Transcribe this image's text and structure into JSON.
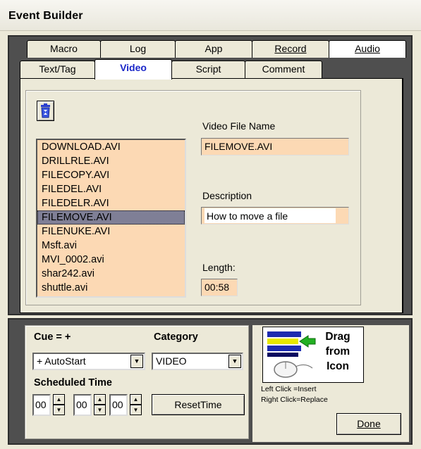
{
  "window": {
    "title": "Event Builder"
  },
  "tabs": {
    "row_back": [
      {
        "label": "Macro"
      },
      {
        "label": "Log"
      },
      {
        "label": "App"
      },
      {
        "label": "Record"
      },
      {
        "label": "Audio"
      }
    ],
    "row_front": [
      {
        "label": "Text/Tag"
      },
      {
        "label": "Video"
      },
      {
        "label": "Script"
      },
      {
        "label": "Comment"
      }
    ],
    "active": "Video"
  },
  "video": {
    "files": [
      "DOWNLOAD.AVI",
      "DRILLRLE.AVI",
      "FILECOPY.AVI",
      "FILEDEL.AVI",
      "FILEDELR.AVI",
      "FILEMOVE.AVI",
      "FILENUKE.AVI",
      "Msft.avi",
      "MVI_0002.avi",
      "shar242.avi",
      "shuttle.avi"
    ],
    "selected_index": 5,
    "file_name_label": "Video File Name",
    "file_name_value": "FILEMOVE.AVI",
    "description_label": "Description",
    "description_value": "How to move a file",
    "length_label": "Length:",
    "length_value": "00:58",
    "trash_icon": "recycle-bin-icon"
  },
  "cue": {
    "label": "Cue = +",
    "value": "+ AutoStart",
    "category_label": "Category",
    "category_value": "VIDEO",
    "scheduled_label": "Scheduled Time",
    "hour": "00",
    "minute": "00",
    "second": "00",
    "reset_label": "ResetTime"
  },
  "drag": {
    "text_line1": "Drag",
    "text_line2": "from",
    "text_line3": "Icon",
    "hint_line1": "Left Click  =Insert",
    "hint_line2": "Right Click=Replace",
    "icon": "drag-insert-mouse-icon"
  },
  "done_label": "Done",
  "colors": {
    "field_bg": "#fcd9b4",
    "active_tab_text": "#1a26c8",
    "panel_border": "#4f4f4f"
  }
}
